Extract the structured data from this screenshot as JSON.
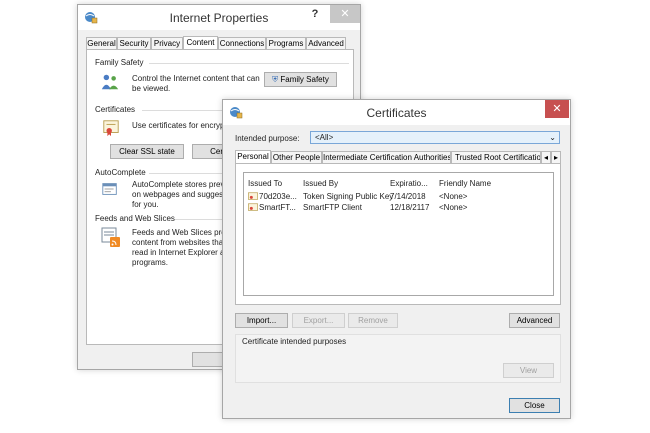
{
  "internet_properties": {
    "title": "Internet Properties",
    "help": "?",
    "close": "✕",
    "tabs": [
      "General",
      "Security",
      "Privacy",
      "Content",
      "Connections",
      "Programs",
      "Advanced"
    ],
    "active_tab": "Content",
    "family_safety": {
      "heading": "Family Safety",
      "text1": "Control the Internet content that can",
      "text2": "be viewed.",
      "button": "Family Safety"
    },
    "certificates": {
      "heading": "Certificates",
      "text": "Use certificates for encrypte",
      "clear_ssl_button": "Clear SSL state",
      "certificates_button": "Certi"
    },
    "autocomplete": {
      "heading": "AutoComplete",
      "text1": "AutoComplete stores previo",
      "text2": "on webpages and suggests",
      "text3": "for you."
    },
    "feeds": {
      "heading": "Feeds and Web Slices",
      "text1": "Feeds and Web Slices provi",
      "text2": "content from websites that",
      "text3": "read in Internet Explorer an",
      "text4": "programs."
    },
    "ok_button": "OK"
  },
  "certificates_dialog": {
    "title": "Certificates",
    "close": "✕",
    "intended_purpose_label": "Intended purpose:",
    "intended_purpose_value": "<All>",
    "tabs": [
      "Personal",
      "Other People",
      "Intermediate Certification Authorities",
      "Trusted Root Certification"
    ],
    "active_tab": "Personal",
    "scroll_left": "◂",
    "scroll_right": "▸",
    "columns": [
      "Issued To",
      "Issued By",
      "Expiratio...",
      "Friendly Name"
    ],
    "rows": [
      {
        "issued_to": "70d203e...",
        "issued_by": "Token Signing Public Key",
        "expiration": "7/14/2018",
        "friendly_name": "<None>"
      },
      {
        "issued_to": "SmartFT...",
        "issued_by": "SmartFTP Client",
        "expiration": "12/18/2117",
        "friendly_name": "<None>"
      }
    ],
    "import_button": "Import...",
    "export_button": "Export...",
    "remove_button": "Remove",
    "advanced_button": "Advanced",
    "purposes_label": "Certificate intended purposes",
    "view_button": "View",
    "close_button": "Close"
  },
  "colors": {
    "accent_border": "#3c7fb1",
    "close_red": "#c75050",
    "window_bg": "#f0f0f0"
  }
}
